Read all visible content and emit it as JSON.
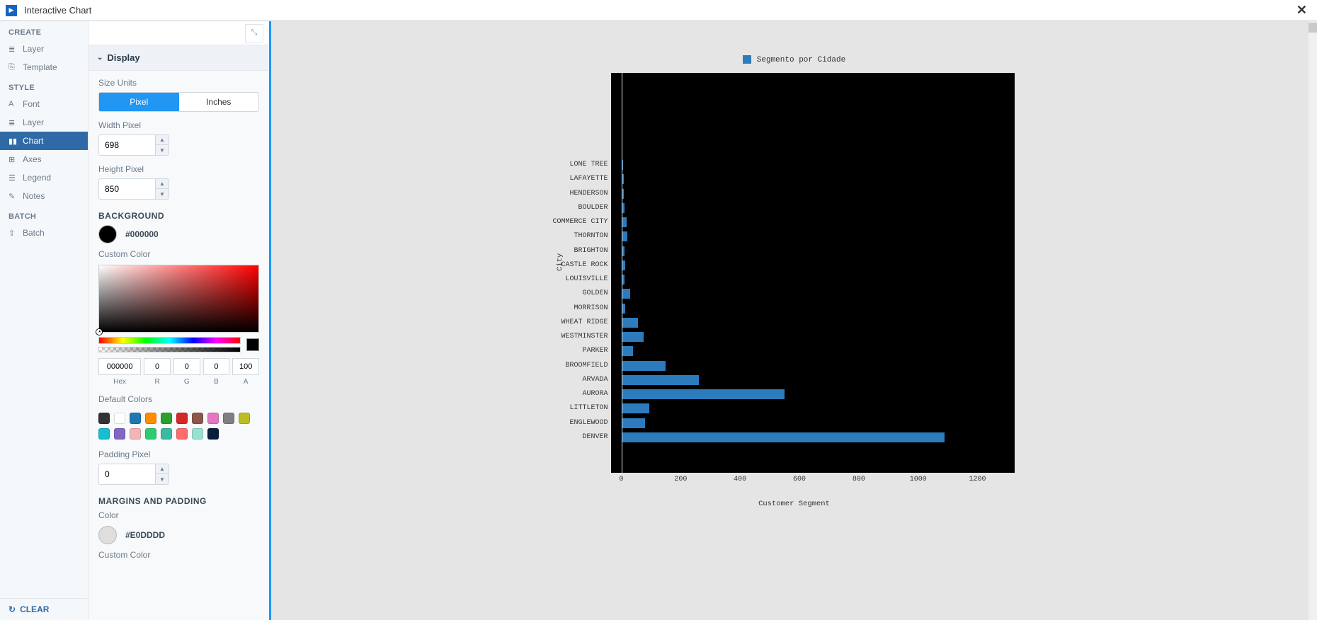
{
  "window": {
    "title": "Interactive Chart"
  },
  "nav": {
    "create": {
      "header": "CREATE",
      "layer": "Layer",
      "template": "Template"
    },
    "style": {
      "header": "STYLE",
      "font": "Font",
      "layer": "Layer",
      "chart": "Chart",
      "axes": "Axes",
      "legend": "Legend",
      "notes": "Notes"
    },
    "batch": {
      "header": "BATCH",
      "batch": "Batch"
    },
    "clear": "CLEAR"
  },
  "panel": {
    "display_header": "Display",
    "size_units_label": "Size Units",
    "size_units": {
      "pixel": "Pixel",
      "inches": "Inches"
    },
    "width_label": "Width Pixel",
    "width_value": "698",
    "height_label": "Height Pixel",
    "height_value": "850",
    "background_header": "BACKGROUND",
    "bg_hex": "#000000",
    "custom_color_label": "Custom Color",
    "hex_label": "Hex",
    "r_label": "R",
    "g_label": "G",
    "b_label": "B",
    "a_label": "A",
    "hex_val": "000000",
    "r_val": "0",
    "g_val": "0",
    "b_val": "0",
    "a_val": "100",
    "default_colors_label": "Default Colors",
    "palette": [
      "#323232",
      "#ffffff",
      "#1f77b4",
      "#ff8c00",
      "#2ca02c",
      "#d62728",
      "#8c564b",
      "#e377c2",
      "#7f7f7f",
      "#bcbd22",
      "#17becf",
      "#8265c4",
      "#f2b5b5",
      "#2ecc71",
      "#3cba9f",
      "#ff6b6b",
      "#98e1d0",
      "#0b1e3b"
    ],
    "padding_label": "Padding Pixel",
    "padding_value": "0",
    "margins_header": "MARGINS AND PADDING",
    "margins_color_label": "Color",
    "margins_color_hex": "#E0DDDD",
    "custom_color_label2": "Custom Color"
  },
  "chart_data": {
    "type": "bar",
    "orientation": "horizontal",
    "legend": "Segmento por Cidade",
    "xlabel": "Customer Segment",
    "ylabel": "City",
    "xlim": [
      0,
      1300
    ],
    "xticks": [
      0,
      200,
      400,
      600,
      800,
      1000,
      1200
    ],
    "categories": [
      "LONE TREE",
      "LAFAYETTE",
      "HENDERSON",
      "BOULDER",
      "COMMERCE CITY",
      "THORNTON",
      "BRIGHTON",
      "CASTLE ROCK",
      "LOUISVILLE",
      "GOLDEN",
      "MORRISON",
      "WHEAT RIDGE",
      "WESTMINSTER",
      "PARKER",
      "BROOMFIELD",
      "ARVADA",
      "AURORA",
      "LITTLETON",
      "ENGLEWOOD",
      "DENVER"
    ],
    "values": [
      7,
      8,
      8,
      10,
      18,
      20,
      10,
      12,
      10,
      30,
      12,
      55,
      75,
      40,
      150,
      260,
      550,
      95,
      80,
      1090
    ],
    "bar_color": "#2b7bbd",
    "plot_bg": "#000000",
    "figure_bg": "#e5e5e5"
  }
}
